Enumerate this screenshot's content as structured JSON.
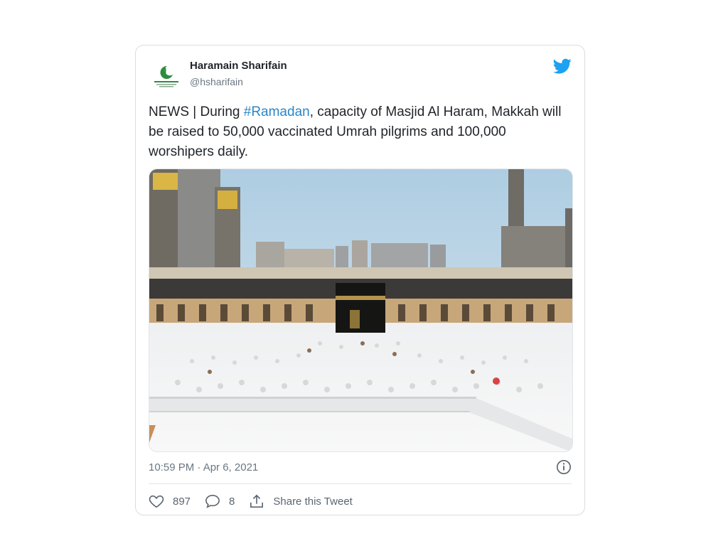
{
  "tweet": {
    "author_name": "Haramain Sharifain",
    "handle": "@hsharifain",
    "text_before": "NEWS | During ",
    "hashtag": "#Ramadan",
    "text_after": ", capacity of Masjid Al Haram, Makkah will be raised to 50,000 vaccinated Umrah pilgrims and 100,000 worshipers daily.",
    "timestamp": "10:59 PM · Apr 6, 2021",
    "likes": "897",
    "replies": "8",
    "share_label": "Share this Tweet"
  },
  "colors": {
    "twitter_blue": "#1da1f2",
    "hashtag": "#2a86c8",
    "logo_green": "#2e8b3e"
  },
  "icons": {
    "brand": "twitter-bird-icon",
    "info": "info-icon",
    "like": "heart-icon",
    "reply": "reply-bubble-icon",
    "share": "share-upload-icon"
  }
}
